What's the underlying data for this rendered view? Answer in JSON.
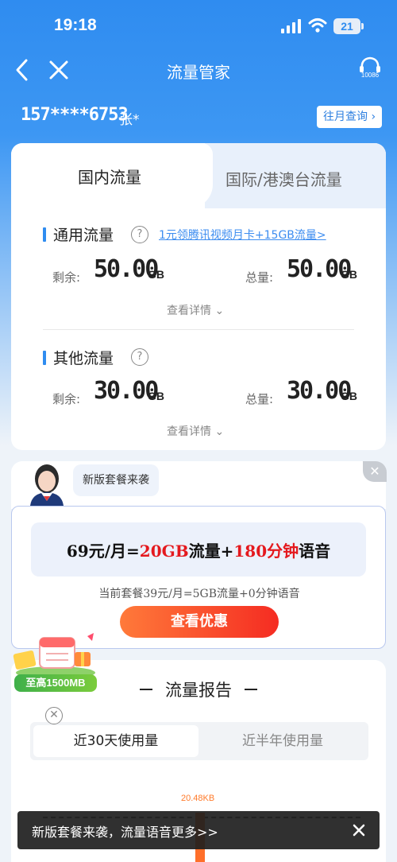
{
  "status_bar": {
    "time": "19:18",
    "battery": "21"
  },
  "nav": {
    "title": "流量管家",
    "service_number": "10086"
  },
  "user": {
    "phone": "157****6753",
    "name": "张*",
    "history_button": "往月查询"
  },
  "tabs": {
    "domestic": "国内流量",
    "international": "国际/港澳台流量"
  },
  "general": {
    "title": "通用流量",
    "help": "?",
    "promo_link": "1元领腾讯视频月卡+15GB流量>",
    "remaining_label": "剩余:",
    "remaining_value": "50.00",
    "remaining_unit": "GB",
    "total_label": "总量:",
    "total_value": "50.00",
    "total_unit": "GB",
    "detail": "查看详情"
  },
  "other": {
    "title": "其他流量",
    "help": "?",
    "remaining_label": "剩余:",
    "remaining_value": "30.00",
    "remaining_unit": "GB",
    "total_label": "总量:",
    "total_value": "30.00",
    "total_unit": "GB",
    "detail": "查看详情"
  },
  "promo": {
    "bubble": "新版套餐来袭",
    "offer_price": "69元/月=",
    "offer_data": "20GB",
    "offer_mid": "流量+",
    "offer_minutes": "180分钟",
    "offer_end": "语音",
    "current_plan": "当前套餐39元/月=5GB流量+0分钟语音",
    "button": "查看优惠"
  },
  "gift": {
    "label": "至高1500MB"
  },
  "report": {
    "title": "流量报告",
    "tab_30": "近30天使用量",
    "tab_half_year": "近半年使用量",
    "peak_label": "20.48KB"
  },
  "toast": {
    "text": "新版套餐来袭，流量语音更多>>"
  },
  "colors": {
    "primary": "#2f8cf0",
    "offer_red": "#e4191e",
    "cta_orange": "#ff6f2a",
    "gift_green": "#3fb04a"
  }
}
